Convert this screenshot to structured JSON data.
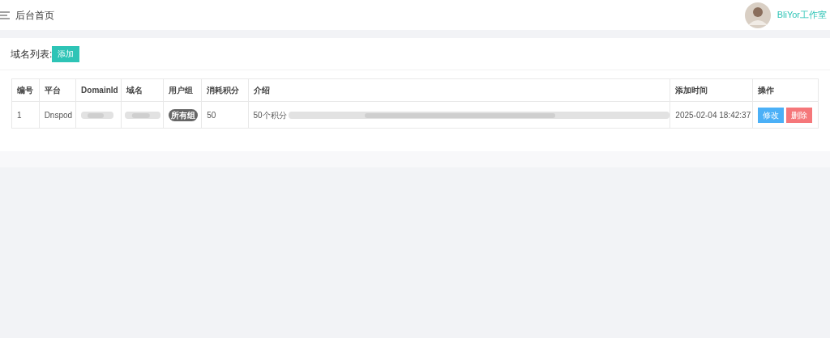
{
  "header": {
    "title": "后台首页",
    "user_name": "BliYor工作室"
  },
  "panel": {
    "title": "域名列表:",
    "add_button": "添加"
  },
  "table": {
    "columns": [
      "编号",
      "平台",
      "DomainId",
      "域名",
      "用户组",
      "消耗积分",
      "介绍",
      "添加时间",
      "操作"
    ],
    "rows": [
      {
        "id": "1",
        "platform": "Dnspod",
        "group": "所有组",
        "cost": "50",
        "intro": "50个积分",
        "time": "2025-02-04 18:42:37",
        "actions": [
          "修改",
          "删除"
        ]
      }
    ]
  }
}
